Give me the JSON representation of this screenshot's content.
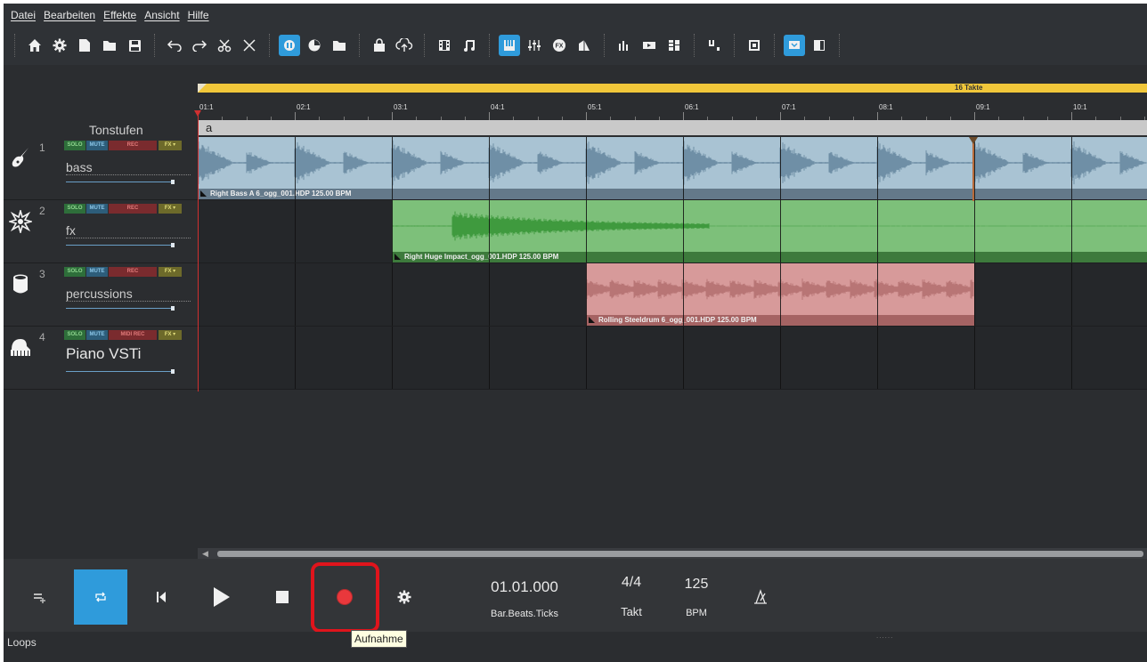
{
  "menu": [
    "Datei",
    "Bearbeiten",
    "Effekte",
    "Ansicht",
    "Hilfe"
  ],
  "toolbar_icons": [
    "home-icon",
    "settings-icon",
    "new-file-icon",
    "open-folder-icon",
    "save-icon",
    "undo-icon",
    "redo-icon",
    "cut-icon",
    "delete-icon",
    "mixer-view-icon",
    "dial-icon",
    "folder-icon",
    "shop-icon",
    "cloud-upload-icon",
    "film-icon",
    "music-note-icon",
    "piano-keys-icon",
    "eq-icon",
    "fx-icon",
    "brush-icon",
    "bars-icon",
    "video-icon",
    "grid-icon",
    "tuner-icon",
    "screen-icon",
    "monitor-icon",
    "panel-icon"
  ],
  "ruler": {
    "loop_label": "16 Takte",
    "bars": [
      "01:1",
      "02:1",
      "03:1",
      "04:1",
      "05:1",
      "06:1",
      "07:1",
      "08:1",
      "09:1",
      "10:1"
    ],
    "marker": "a"
  },
  "arranger_title": "Tonstufen",
  "track_buttons": {
    "solo": "SOLO",
    "mute": "MUTE",
    "rec": "REC",
    "midi_rec": "MIDI REC",
    "fx": "FX ▾"
  },
  "tracks": [
    {
      "num": "1",
      "name": "bass",
      "icon": "guitar-icon",
      "rec": "REC"
    },
    {
      "num": "2",
      "name": "fx",
      "icon": "explosion-icon",
      "rec": "REC"
    },
    {
      "num": "3",
      "name": "percussions",
      "icon": "drum-icon",
      "rec": "REC"
    },
    {
      "num": "4",
      "name": "Piano VSTi",
      "icon": "piano-icon",
      "rec": "MIDI REC"
    }
  ],
  "clips": [
    {
      "track": 1,
      "title": "Right Bass A 6_ogg_001.HDP  125.00 BPM",
      "color": "#a9c3d3"
    },
    {
      "track": 2,
      "title": "Right Huge Impact_ogg_001.HDP  125.00 BPM",
      "color": "#7dc07a"
    },
    {
      "track": 3,
      "title": "Rolling Steeldrum 6_ogg_001.HDP  125.00 BPM",
      "color": "#d79a9a"
    }
  ],
  "transport": {
    "position": "01.01.000",
    "position_label": "Bar.Beats.Ticks",
    "time_signature": "4/4",
    "time_signature_label": "Takt",
    "tempo": "125",
    "tempo_label": "BPM",
    "tooltip": "Aufnahme"
  },
  "status": {
    "text": "Loops"
  }
}
